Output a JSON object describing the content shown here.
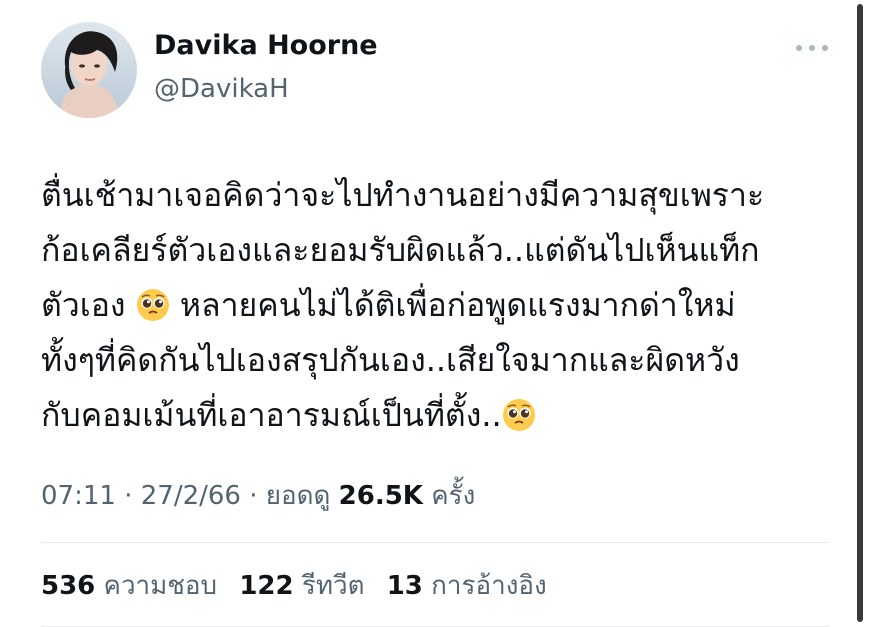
{
  "author": {
    "name": "Davika Hoorne",
    "handle": "@DavikaH"
  },
  "tweet": {
    "lines": [
      "ตื่นเช้ามาเจอคิดว่าจะไปทำงานอย่างมีความสุขเพราะ",
      "ก้อเคลียร์ตัวเองและยอมรับผิดแล้ว..แต่ดันไปเห็นแท็ก",
      "ตัวเอง",
      "หลายคนไม่ได้ติเพื่อก่อพูดแรงมากด่าใหม่",
      "ทั้งๆที่คิดกันไปเองสรุปกันเอง..เสียใจมากและผิดหวัง",
      "กับคอมเม้นที่เอาอารมณ์เป็นที่ตั้ง.."
    ],
    "emoji_name": "pleading-face-emoji"
  },
  "meta": {
    "time": "07:11",
    "sep1": " · ",
    "date": "27/2/66",
    "sep2": " · ",
    "views_label": "ยอดดู",
    "views_count": "26.5K",
    "views_suffix": "ครั้ง"
  },
  "stats": {
    "likes_count": "536",
    "likes_label": "ความชอบ",
    "retweets_count": "122",
    "retweets_label": "รีทวีต",
    "quotes_count": "13",
    "quotes_label": "การอ้างอิง"
  },
  "colors": {
    "text": "#0f1419",
    "secondary": "#536471",
    "divider": "#e6ecf0"
  }
}
